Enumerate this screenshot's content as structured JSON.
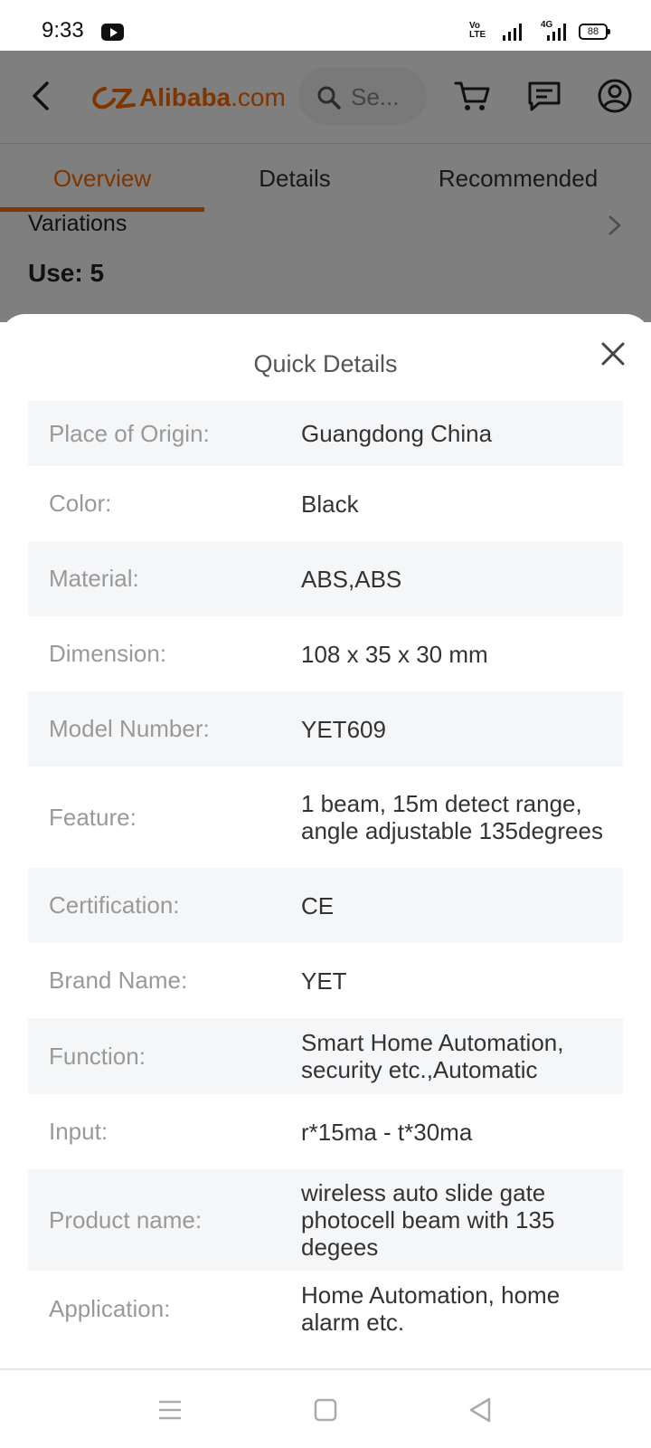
{
  "status_bar": {
    "time": "9:33",
    "volte_top": "Vo",
    "volte_bottom": "LTE",
    "network": "4G",
    "battery": "88"
  },
  "header": {
    "logo_main": "Alibaba",
    "logo_suffix": ".com",
    "search_placeholder": "Se...",
    "brand_color": "#ff6a00"
  },
  "tabs": [
    {
      "label": "Overview",
      "active": true
    },
    {
      "label": "Details",
      "active": false
    },
    {
      "label": "Recommended",
      "active": false
    }
  ],
  "background": {
    "variations_label": "Variations",
    "use_label": "Use: 5"
  },
  "sheet": {
    "title": "Quick Details",
    "rows": [
      {
        "label": "Place of Origin:",
        "value": "Guangdong China"
      },
      {
        "label": "Color:",
        "value": "Black"
      },
      {
        "label": "Material:",
        "value": "ABS,ABS"
      },
      {
        "label": "Dimension:",
        "value": "108 x 35 x 30 mm"
      },
      {
        "label": "Model Number:",
        "value": "YET609"
      },
      {
        "label": "Feature:",
        "value": "1 beam, 15m detect range, angle adjustable 135degrees"
      },
      {
        "label": "Certification:",
        "value": "CE"
      },
      {
        "label": "Brand Name:",
        "value": "YET"
      },
      {
        "label": "Function:",
        "value": "Smart Home Automation, security etc.,Automatic"
      },
      {
        "label": "Input:",
        "value": "r*15ma - t*30ma"
      },
      {
        "label": "Product name:",
        "value": "wireless auto slide gate photocell beam with 135 degees"
      },
      {
        "label": "Application:",
        "value": "Home Automation, home alarm etc."
      }
    ]
  }
}
